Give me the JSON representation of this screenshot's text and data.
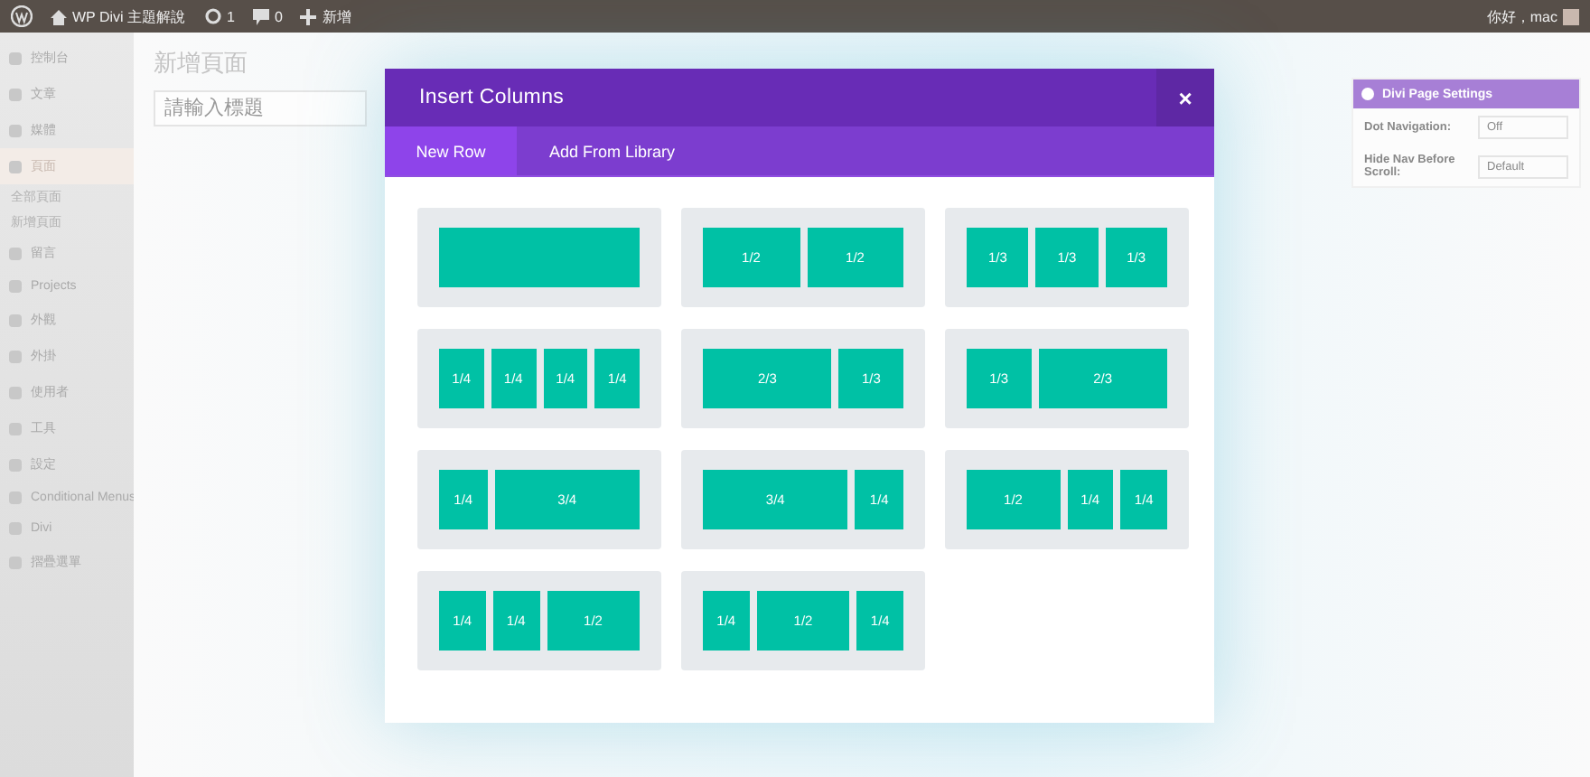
{
  "admin_bar": {
    "site_name": "WP Divi 主題解說",
    "updates": "1",
    "comments": "0",
    "new_label": "新增",
    "greeting": "你好，mac"
  },
  "sidebar": {
    "items": [
      {
        "label": "控制台",
        "kind": "menu",
        "selected": false
      },
      {
        "label": "文章",
        "kind": "menu",
        "selected": false
      },
      {
        "label": "媒體",
        "kind": "menu",
        "selected": false
      },
      {
        "label": "頁面",
        "kind": "menu",
        "selected": true
      },
      {
        "label": "全部頁面",
        "kind": "sub",
        "selected": false
      },
      {
        "label": "新增頁面",
        "kind": "sub",
        "selected": false
      },
      {
        "label": "留言",
        "kind": "menu",
        "selected": false
      },
      {
        "label": "Projects",
        "kind": "menu",
        "selected": false
      },
      {
        "label": "外觀",
        "kind": "menu",
        "selected": false
      },
      {
        "label": "外掛",
        "kind": "menu",
        "selected": false
      },
      {
        "label": "使用者",
        "kind": "menu",
        "selected": false
      },
      {
        "label": "工具",
        "kind": "menu",
        "selected": false
      },
      {
        "label": "設定",
        "kind": "menu",
        "selected": false
      },
      {
        "label": "Conditional Menus",
        "kind": "menu",
        "selected": false
      },
      {
        "label": "Divi",
        "kind": "menu",
        "selected": false
      },
      {
        "label": "摺疊選單",
        "kind": "menu",
        "selected": false
      }
    ]
  },
  "editor": {
    "heading": "新增頁面",
    "title_field": {
      "placeholder": "請輸入標題"
    }
  },
  "page_settings": {
    "title": "Divi Page Settings",
    "fields": [
      {
        "label": "Dot Navigation:",
        "value": "Off"
      },
      {
        "label": "Hide Nav Before Scroll:",
        "value": "Default"
      }
    ]
  },
  "modal": {
    "title": "Insert Columns",
    "close": "×",
    "tabs": [
      {
        "label": "New Row",
        "selected": true
      },
      {
        "label": "Add From Library",
        "selected": false
      }
    ],
    "layouts": [
      {
        "columns": [
          {
            "kind": "full"
          }
        ]
      },
      {
        "columns": [
          {
            "kind": "half",
            "label": "1/2"
          },
          {
            "kind": "half",
            "label": "1/2"
          }
        ]
      },
      {
        "columns": [
          {
            "kind": "third",
            "label": "1/3"
          },
          {
            "kind": "third",
            "label": "1/3"
          },
          {
            "kind": "third",
            "label": "1/3"
          }
        ]
      },
      {
        "columns": [
          {
            "kind": "quarter",
            "label": "1/4"
          },
          {
            "kind": "quarter",
            "label": "1/4"
          },
          {
            "kind": "quarter",
            "label": "1/4"
          },
          {
            "kind": "quarter",
            "label": "1/4"
          }
        ]
      },
      {
        "columns": [
          {
            "kind": "two-thirds",
            "label": "2/3"
          },
          {
            "kind": "third",
            "label": "1/3"
          }
        ]
      },
      {
        "columns": [
          {
            "kind": "third",
            "label": "1/3"
          },
          {
            "kind": "two-thirds",
            "label": "2/3"
          }
        ]
      },
      {
        "columns": [
          {
            "kind": "quarter",
            "label": "1/4"
          },
          {
            "kind": "three-quarters",
            "label": "3/4"
          }
        ]
      },
      {
        "columns": [
          {
            "kind": "three-quarters",
            "label": "3/4"
          },
          {
            "kind": "quarter",
            "label": "1/4"
          }
        ]
      },
      {
        "columns": [
          {
            "kind": "half",
            "label": "1/2"
          },
          {
            "kind": "quarter",
            "label": "1/4"
          },
          {
            "kind": "quarter",
            "label": "1/4"
          }
        ]
      },
      {
        "columns": [
          {
            "kind": "quarter",
            "label": "1/4"
          },
          {
            "kind": "quarter",
            "label": "1/4"
          },
          {
            "kind": "half",
            "label": "1/2"
          }
        ]
      },
      {
        "columns": [
          {
            "kind": "quarter",
            "label": "1/4"
          },
          {
            "kind": "half",
            "label": "1/2"
          },
          {
            "kind": "quarter",
            "label": "1/4"
          }
        ]
      }
    ]
  }
}
